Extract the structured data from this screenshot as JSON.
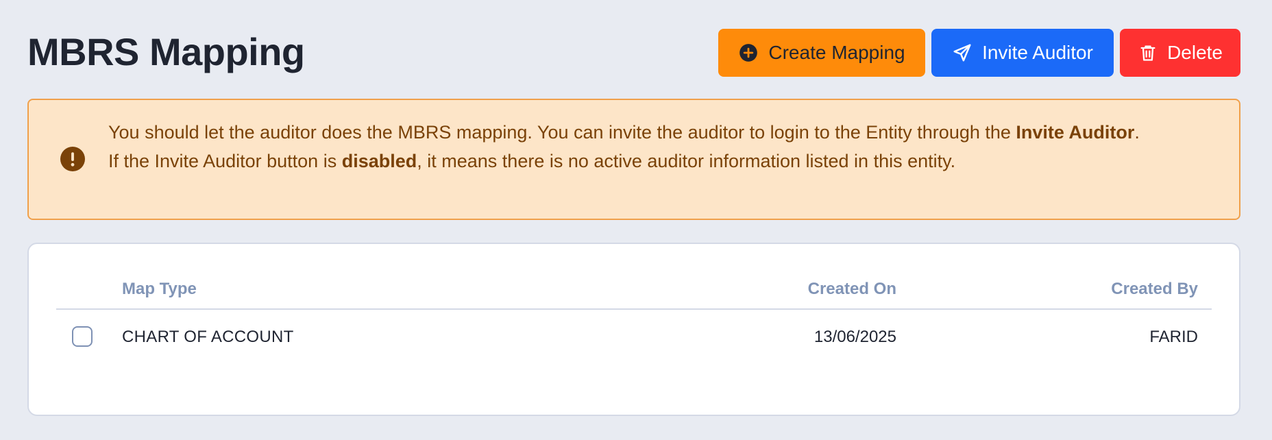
{
  "page": {
    "title": "MBRS Mapping"
  },
  "actions": {
    "create_label": "Create Mapping",
    "invite_label": "Invite Auditor",
    "delete_label": "Delete"
  },
  "alert": {
    "icon": "exclamation-circle-icon",
    "line1_prefix": "You should let the auditor does the MBRS mapping. You can invite the auditor to login to the Entity through the ",
    "line1_bold": "Invite Auditor",
    "line1_suffix": ".",
    "line2_prefix": "If the Invite Auditor button is ",
    "line2_bold": "disabled",
    "line2_suffix": ", it means there is no active auditor information listed in this entity."
  },
  "table": {
    "columns": {
      "map_type": "Map Type",
      "created_on": "Created On",
      "created_by": "Created By"
    },
    "rows": [
      {
        "map_type": "CHART OF ACCOUNT",
        "created_on": "13/06/2025",
        "created_by": "FARID",
        "checked": false
      }
    ]
  },
  "colors": {
    "create_button": "#fe8b0a",
    "invite_button": "#1b6af8",
    "delete_button": "#fe3131",
    "alert_background": "#fde5c8",
    "alert_text": "#7a4208"
  }
}
